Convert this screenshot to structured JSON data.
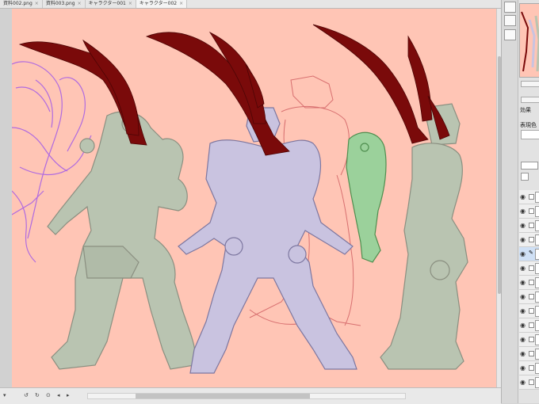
{
  "tabs": [
    {
      "label": "資料002.png"
    },
    {
      "label": "資料003.png"
    },
    {
      "label": "キャラクター001"
    },
    {
      "label": "キャラクター002"
    }
  ],
  "panel": {
    "effect_label": "効果",
    "display_color_label": "表現色"
  },
  "colors": {
    "paper": "#ffc5b5",
    "scarf": "#7a0a0a",
    "armor_gray": "#b9c4b1",
    "armor_lavender": "#c9c3e0",
    "arm_green": "#9bd19b",
    "sketch_purple": "#b06be0",
    "sketch_red": "#d87070"
  },
  "layers": [
    {
      "icon": "eye-icon"
    },
    {
      "icon": "eye-icon"
    },
    {
      "icon": "eye-icon"
    },
    {
      "icon": "eye-icon"
    },
    {
      "icon": "eye-icon"
    },
    {
      "icon": "eye-icon"
    },
    {
      "icon": "eye-icon"
    },
    {
      "icon": "eye-icon"
    },
    {
      "icon": "eye-icon"
    },
    {
      "icon": "eye-icon"
    },
    {
      "icon": "eye-icon"
    },
    {
      "icon": "eye-icon"
    },
    {
      "icon": "eye-icon"
    },
    {
      "icon": "eye-icon"
    }
  ]
}
